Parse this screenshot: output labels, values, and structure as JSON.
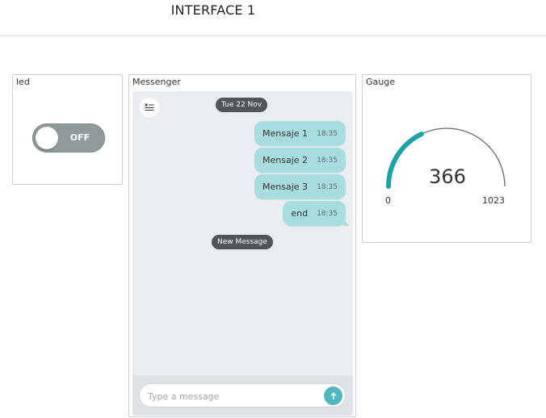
{
  "header": {
    "title": "INTERFACE 1"
  },
  "led": {
    "title": "led",
    "toggle_label": "OFF",
    "state": false
  },
  "messenger": {
    "title": "Messenger",
    "clear_icon": "clear-list-icon",
    "date": "Tue 22 Nov",
    "messages": [
      {
        "text": "Mensaje 1",
        "time": "18:35"
      },
      {
        "text": "Mensaje 2",
        "time": "18:35"
      },
      {
        "text": "Mensaje 3",
        "time": "18:35"
      },
      {
        "text": "end",
        "time": "18:35"
      }
    ],
    "new_message_label": "New Message",
    "input": {
      "value": "",
      "placeholder": "Type a message"
    },
    "send_icon": "arrow-up-icon"
  },
  "gauge": {
    "title": "Gauge",
    "value": "366",
    "min": "0",
    "max": "1023"
  },
  "colors": {
    "accent": "#1ea2a8",
    "bubble": "#a8dde0",
    "pill": "#4f5558",
    "toggle_off": "#909a9b"
  }
}
